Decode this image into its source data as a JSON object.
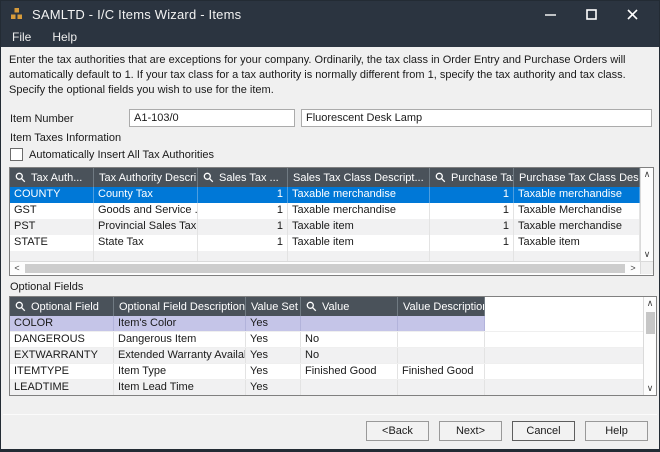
{
  "window": {
    "title": "SAMLTD - I/C Items Wizard - Items",
    "menu": {
      "file": "File",
      "help": "Help"
    }
  },
  "instructions": "Enter the tax authorities that are exceptions for your company. Ordinarily, the tax class in Order Entry and Purchase Orders will automatically default to 1. If your tax class for a tax authority is normally different from 1, specify the tax authority and tax class. Specify the optional fields you wish to use for the item.",
  "item": {
    "label": "Item Number",
    "number": "A1-103/0",
    "description": "Fluorescent Desk Lamp"
  },
  "item_taxes": {
    "section_label": "Item Taxes Information",
    "auto_insert_label": "Automatically Insert All Tax Authorities",
    "auto_insert_checked": false
  },
  "tax_table": {
    "columns": [
      {
        "label": "Tax Auth...",
        "search_icon": true
      },
      {
        "label": "Tax Authority Descri...",
        "search_icon": false
      },
      {
        "label": "Sales Tax ...",
        "search_icon": true
      },
      {
        "label": "Sales Tax Class Descript...",
        "search_icon": false
      },
      {
        "label": "Purchase Tax Cl...",
        "search_icon": true
      },
      {
        "label": "Purchase Tax Class Des...",
        "search_icon": false
      }
    ],
    "rows": [
      [
        "COUNTY",
        "County Tax",
        "1",
        "Taxable merchandise",
        "1",
        "Taxable merchandise"
      ],
      [
        "GST",
        "Goods and Service ...",
        "1",
        "Taxable merchandise",
        "1",
        "Taxable Merchandise"
      ],
      [
        "PST",
        "Provincial Sales Tax",
        "1",
        "Taxable item",
        "1",
        "Taxable merchandise"
      ],
      [
        "STATE",
        "State Tax",
        "1",
        "Taxable item",
        "1",
        "Taxable item"
      ]
    ],
    "selected_row_index": 0
  },
  "optional_fields": {
    "section_label": "Optional Fields",
    "columns": [
      {
        "label": "Optional Field",
        "search_icon": true
      },
      {
        "label": "Optional Field Description",
        "search_icon": false
      },
      {
        "label": "Value Set",
        "search_icon": false
      },
      {
        "label": "Value",
        "search_icon": true
      },
      {
        "label": "Value Description",
        "search_icon": false
      }
    ],
    "rows": [
      [
        "COLOR",
        "Item's Color",
        "Yes",
        "",
        ""
      ],
      [
        "DANGEROUS",
        "Dangerous Item",
        "Yes",
        "No",
        ""
      ],
      [
        "EXTWARRANTY",
        "Extended Warranty Available",
        "Yes",
        "No",
        ""
      ],
      [
        "ITEMTYPE",
        "Item Type",
        "Yes",
        "Finished Good",
        "Finished Good"
      ],
      [
        "LEADTIME",
        "Item Lead Time",
        "Yes",
        "",
        ""
      ]
    ],
    "selected_row_index": 0
  },
  "buttons": {
    "back": "<Back",
    "next": "Next>",
    "cancel": "Cancel",
    "help": "Help"
  },
  "icons": {
    "app": "gold-blocks-icon",
    "search": "magnifier-icon",
    "minimize": "minimize-icon",
    "maximize": "maximize-icon",
    "close": "close-icon",
    "scroll_up": "∧",
    "scroll_down": "∨",
    "scroll_left": "<",
    "scroll_right": ">"
  },
  "colors": {
    "titlebar": "#2B3440",
    "grid_header": "#4A525A",
    "selection_blue": "#0078D7",
    "selection_lavender": "#C5C5E8",
    "icon_gold": "#D79B3B"
  }
}
